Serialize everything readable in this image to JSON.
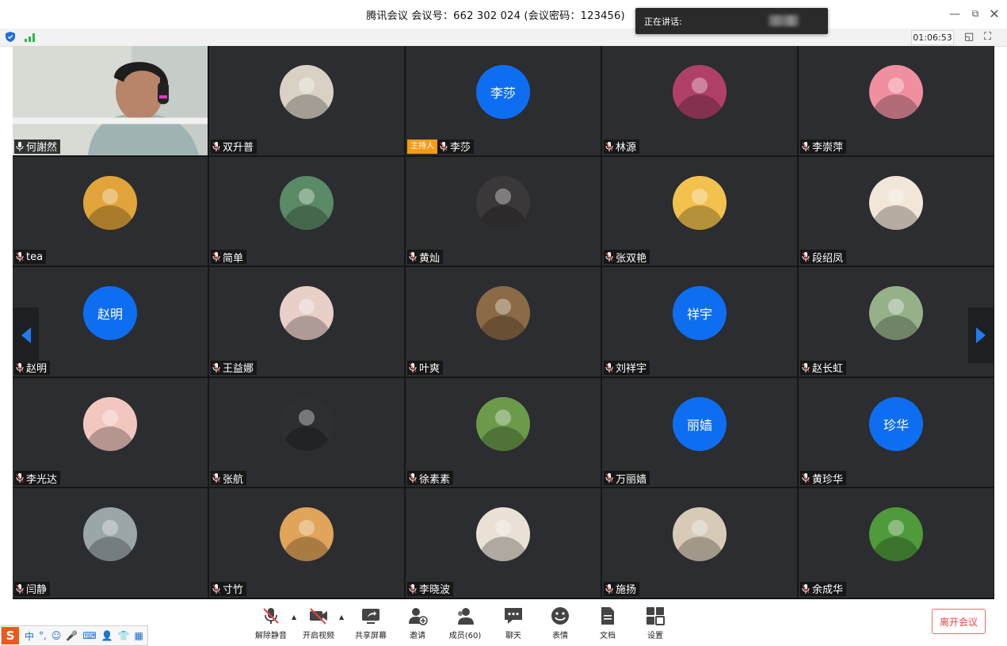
{
  "titlebar": {
    "title": "腾讯会议 会议号：662 302 024  (会议密码：123456)",
    "minimize_glyph": "—",
    "restore_glyph": "⧉",
    "close_glyph": "✕"
  },
  "speaking_popup": {
    "label": "正在讲话:"
  },
  "statusbar": {
    "timer": "01:06:53",
    "shield_icon": "shield-icon",
    "signal_icon": "signal-icon",
    "layout_glyph": "◱",
    "fullscreen_glyph": "⛶"
  },
  "participants": [
    {
      "name": "何謝然",
      "avatar_type": "video",
      "host": false
    },
    {
      "name": "双升普",
      "avatar_type": "photo",
      "color": "#d9d2c4",
      "host": false
    },
    {
      "name": "李莎",
      "avatar_type": "text",
      "initials": "李莎",
      "host": true
    },
    {
      "name": "林源",
      "avatar_type": "photo",
      "color": "#b0406a",
      "host": false
    },
    {
      "name": "李崇萍",
      "avatar_type": "photo",
      "color": "#f08fa0",
      "host": false
    },
    {
      "name": "tea",
      "avatar_type": "photo",
      "color": "#e1a43a",
      "host": false
    },
    {
      "name": "简单",
      "avatar_type": "photo",
      "color": "#5a8a66",
      "host": false
    },
    {
      "name": "黄灿",
      "avatar_type": "photo",
      "color": "#3a3838",
      "host": false
    },
    {
      "name": "张双艳",
      "avatar_type": "photo",
      "color": "#f2c14e",
      "host": false
    },
    {
      "name": "段绍凤",
      "avatar_type": "photo",
      "color": "#f1e6d8",
      "host": false
    },
    {
      "name": "赵明",
      "avatar_type": "text",
      "initials": "赵明",
      "host": false
    },
    {
      "name": "王益娜",
      "avatar_type": "photo",
      "color": "#e8cfc8",
      "host": false
    },
    {
      "name": "叶爽",
      "avatar_type": "photo",
      "color": "#8b6a46",
      "host": false
    },
    {
      "name": "刘祥宇",
      "avatar_type": "text",
      "initials": "祥宇",
      "host": false
    },
    {
      "name": "赵长虹",
      "avatar_type": "photo",
      "color": "#96b08a",
      "host": false
    },
    {
      "name": "李光达",
      "avatar_type": "photo",
      "color": "#f2c7c0",
      "host": false
    },
    {
      "name": "张航",
      "avatar_type": "photo",
      "color": "#2e2f33",
      "host": false
    },
    {
      "name": "徐素素",
      "avatar_type": "photo",
      "color": "#6b9a4a",
      "host": false
    },
    {
      "name": "万丽嫱",
      "avatar_type": "text",
      "initials": "丽嫱",
      "host": false
    },
    {
      "name": "黄珍华",
      "avatar_type": "text",
      "initials": "珍华",
      "host": false
    },
    {
      "name": "闫静",
      "avatar_type": "photo",
      "color": "#9aa6a8",
      "host": false
    },
    {
      "name": "寸竹",
      "avatar_type": "photo",
      "color": "#e0a45a",
      "host": false
    },
    {
      "name": "李晓波",
      "avatar_type": "photo",
      "color": "#e9e1d6",
      "host": false
    },
    {
      "name": "施扬",
      "avatar_type": "photo",
      "color": "#d7cbb8",
      "host": false
    },
    {
      "name": "余成华",
      "avatar_type": "photo",
      "color": "#4f9a3a",
      "host": false
    }
  ],
  "host_label": "主持人",
  "toolbar": {
    "items": [
      {
        "label": "解除静音",
        "icon": "muted-mic-icon"
      },
      {
        "label": "开启视频",
        "icon": "video-off-icon"
      },
      {
        "label": "共享屏幕",
        "icon": "share-screen-icon"
      },
      {
        "label": "邀请",
        "icon": "invite-icon"
      },
      {
        "label": "成员(60)",
        "icon": "members-icon"
      },
      {
        "label": "聊天",
        "icon": "chat-icon"
      },
      {
        "label": "表情",
        "icon": "emoji-icon"
      },
      {
        "label": "文档",
        "icon": "document-icon"
      },
      {
        "label": "设置",
        "icon": "settings-icon"
      }
    ],
    "caret_glyph": "▲",
    "leave_label": "离开会议"
  },
  "ime_bar": {
    "logo": "S",
    "items": [
      "中",
      "°,",
      "☺",
      "🎤",
      "⌨",
      "👤",
      "👕",
      "▦"
    ]
  },
  "colors": {
    "grid_bg": "#151617",
    "tile_bg": "#2b2d30",
    "avatar_blue": "#0e6ef2",
    "host_orange": "#f29b16",
    "leave_red": "#e64545"
  }
}
